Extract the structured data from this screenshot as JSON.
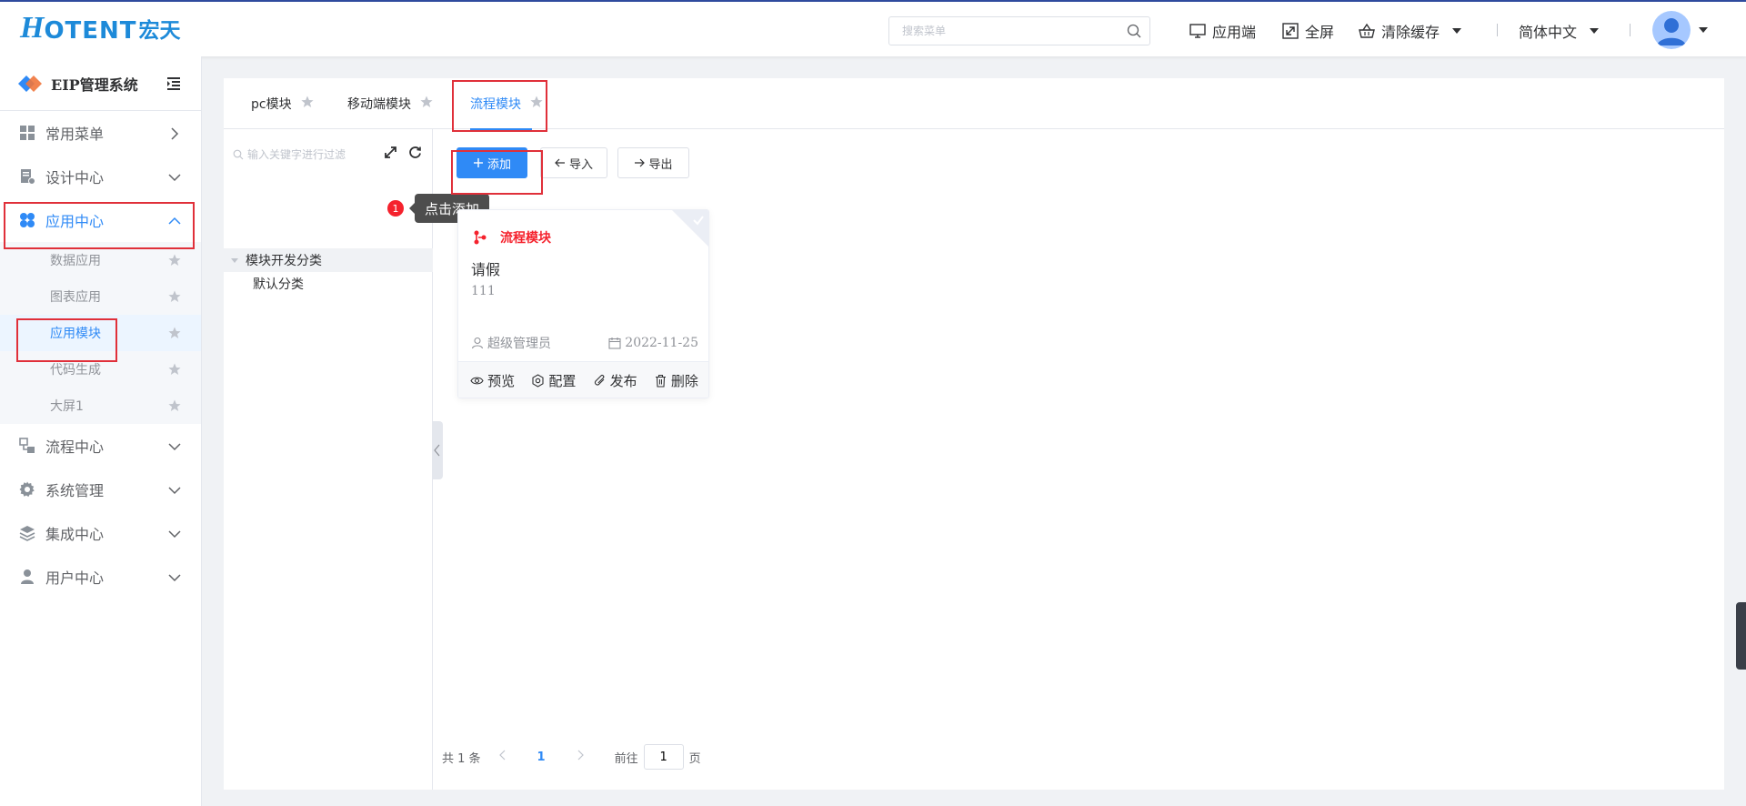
{
  "header": {
    "logo_prefix": "H",
    "logo_text": "OTENT",
    "logo_cn": "宏天",
    "search_placeholder": "搜索菜单",
    "app_label": "应用端",
    "fullscreen_label": "全屏",
    "clear_cache_label": "清除缓存",
    "language_label": "简体中文"
  },
  "sidebar": {
    "system_title": "EIP管理系统",
    "menus": [
      {
        "label": "常用菜单"
      },
      {
        "label": "设计中心"
      },
      {
        "label": "应用中心"
      },
      {
        "label": "流程中心"
      },
      {
        "label": "系统管理"
      },
      {
        "label": "集成中心"
      },
      {
        "label": "用户中心"
      }
    ],
    "app_center_items": [
      {
        "label": "数据应用"
      },
      {
        "label": "图表应用"
      },
      {
        "label": "应用模块"
      },
      {
        "label": "代码生成"
      },
      {
        "label": "大屏1"
      }
    ]
  },
  "tabs": [
    {
      "label": "pc模块"
    },
    {
      "label": "移动端模块"
    },
    {
      "label": "流程模块"
    }
  ],
  "tree": {
    "filter_placeholder": "输入关键字进行过滤",
    "root_label": "模块开发分类",
    "child_label": "默认分类"
  },
  "toolbar": {
    "add_label": "添加",
    "import_label": "导入",
    "export_label": "导出"
  },
  "guide": {
    "step": "1",
    "tip": "点击添加"
  },
  "card": {
    "type_tag": "流程模块",
    "title": "请假",
    "description": "111",
    "creator": "超级管理员",
    "date": "2022-11-25",
    "actions": {
      "preview": "预览",
      "config": "配置",
      "publish": "发布",
      "delete": "删除"
    }
  },
  "pagination": {
    "total_text": "共 1 条",
    "current_page": "1",
    "goto_label": "前往",
    "goto_value": "1",
    "page_suffix": "页"
  },
  "colors": {
    "primary": "#2f8af6",
    "danger": "#f5222d",
    "highlight": "#e0303a",
    "brand": "#1d8ad9"
  }
}
